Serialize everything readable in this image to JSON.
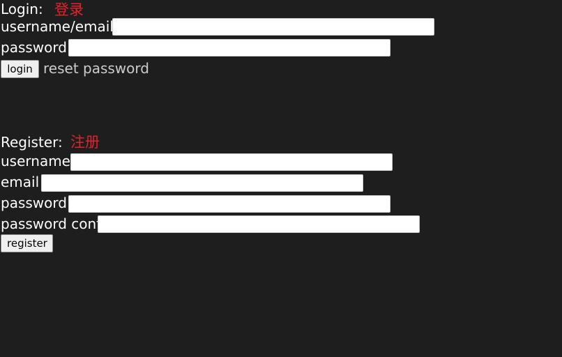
{
  "colors": {
    "background": "#1e1e1e",
    "text": "#ffffff",
    "accent_red": "#e0242b",
    "link_gray": "#cccccc"
  },
  "login": {
    "heading": "Login:",
    "heading_cn": "登录",
    "username_email_label": "username/email",
    "username_email_value": "",
    "password_label": "password",
    "password_value": "",
    "login_button": "login",
    "reset_link": "reset password"
  },
  "register": {
    "heading": "Register:",
    "heading_cn": "注册",
    "username_label": "username",
    "username_value": "",
    "email_label": "email",
    "email_value": "",
    "password_label": "password",
    "password_value": "",
    "password_confirm_label": "password conf",
    "password_confirm_value": "",
    "register_button": "register"
  }
}
